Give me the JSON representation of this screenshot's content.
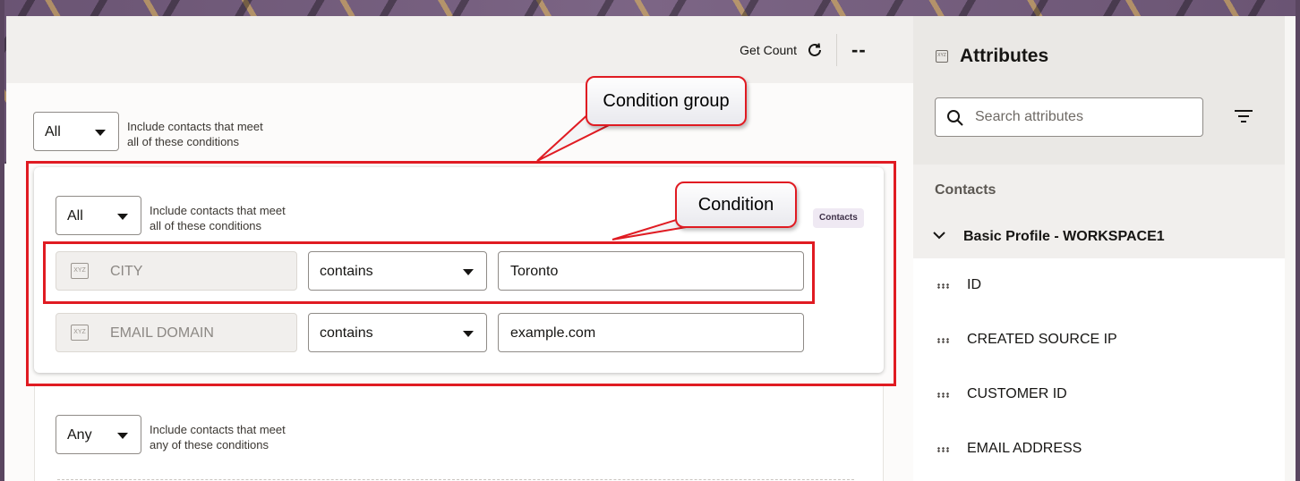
{
  "topbar": {
    "get_count_label": "Get Count",
    "count_value": "--"
  },
  "root_group": {
    "match": "All",
    "hint_line1": "Include contacts that meet",
    "hint_line2": "all of these conditions"
  },
  "condition_group": {
    "match": "All",
    "hint_line1": "Include contacts that meet",
    "hint_line2": "all of these conditions",
    "badge": "Contacts",
    "conditions": [
      {
        "attribute": "CITY",
        "operator": "contains",
        "value": "Toronto"
      },
      {
        "attribute": "EMAIL DOMAIN",
        "operator": "contains",
        "value": "example.com"
      }
    ]
  },
  "second_group": {
    "match": "Any",
    "hint_line1": "Include contacts that meet",
    "hint_line2": "any of these conditions"
  },
  "annotations": {
    "group_callout": "Condition group",
    "condition_callout": "Condition",
    "color": "#e01b22"
  },
  "attributes_panel": {
    "title": "Attributes",
    "search_placeholder": "Search attributes",
    "section": "Contacts",
    "tree_title": "Basic Profile - WORKSPACE1",
    "items": [
      {
        "label": "ID"
      },
      {
        "label": "CREATED SOURCE IP"
      },
      {
        "label": "CUSTOMER ID"
      },
      {
        "label": "EMAIL ADDRESS"
      }
    ]
  },
  "icons": {
    "attr_type": "XYZ"
  }
}
